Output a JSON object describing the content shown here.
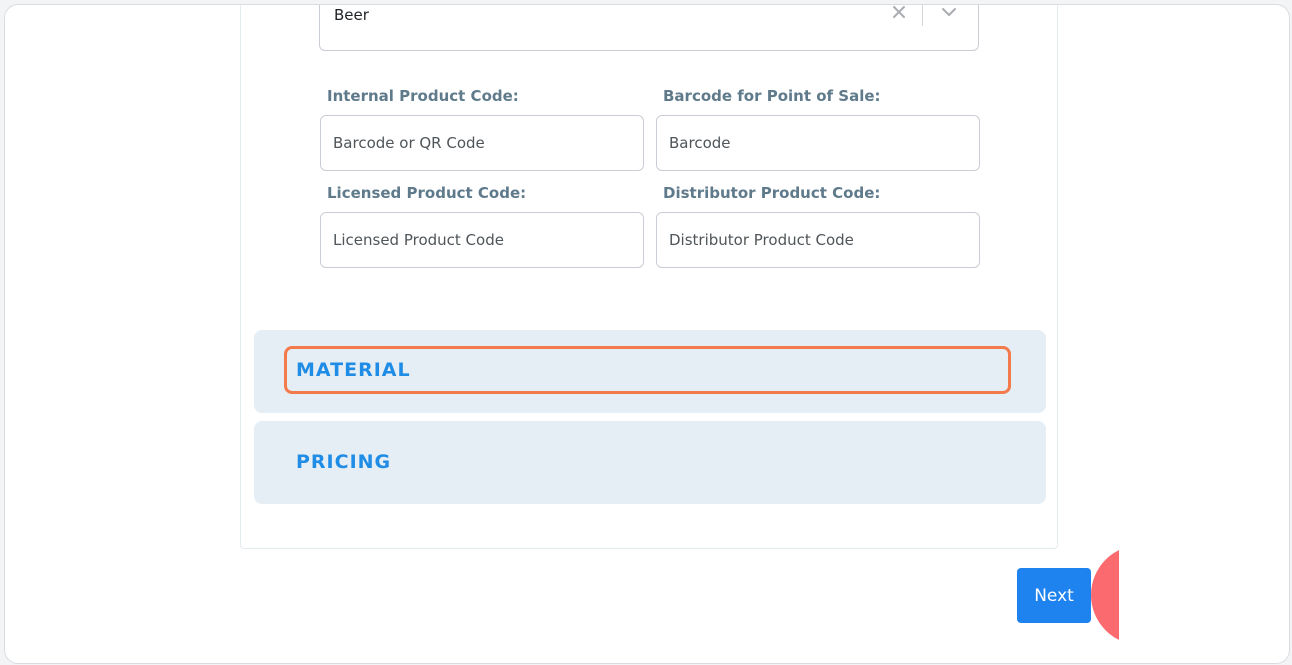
{
  "category_select": {
    "value": "Beer"
  },
  "fields": {
    "internal_product_code": {
      "label": "Internal Product Code:",
      "placeholder": "Barcode or QR Code"
    },
    "barcode_pos": {
      "label": "Barcode for Point of Sale:",
      "placeholder": "Barcode"
    },
    "licensed_product_code": {
      "label": "Licensed Product Code:",
      "placeholder": "Licensed Product Code"
    },
    "distributor_product_code": {
      "label": "Distributor Product Code:",
      "placeholder": "Distributor Product Code"
    }
  },
  "sections": {
    "material": "MATERIAL",
    "pricing": "PRICING"
  },
  "actions": {
    "next_label": "Next"
  },
  "colors": {
    "accent": "#1e82ef",
    "section_title": "#1f8ce6",
    "section_bg": "#e6eef5",
    "highlight": "#f27a4b",
    "fab": "#fb6a6e"
  }
}
